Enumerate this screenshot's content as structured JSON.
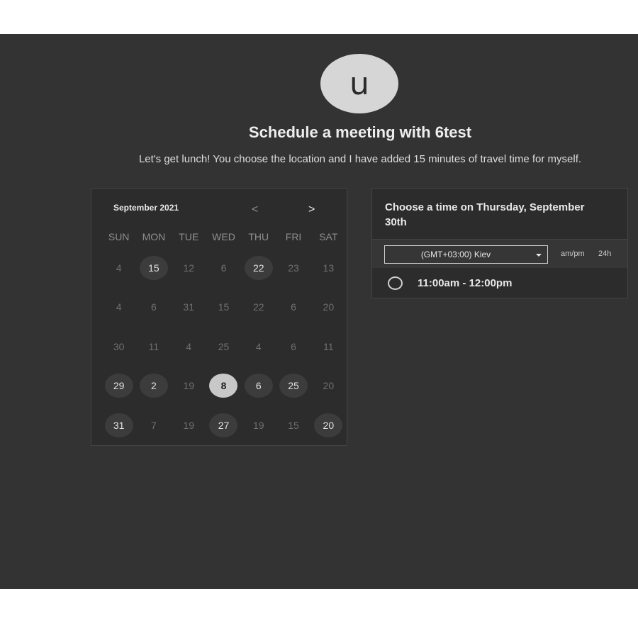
{
  "header": {
    "avatar_initial": "u",
    "title": "Schedule a meeting with 6test",
    "description": "Let's get lunch! You choose the location and I have added 15 minutes of travel time for myself."
  },
  "calendar": {
    "month_label": "September 2021",
    "prev_icon": "chevron-left-icon",
    "next_icon": "chevron-right-icon",
    "prev_glyph": "<",
    "next_glyph": ">",
    "weekdays": [
      "SUN",
      "MON",
      "TUE",
      "WED",
      "THU",
      "FRI",
      "SAT"
    ],
    "weeks": [
      [
        {
          "label": "4",
          "state": "disabled"
        },
        {
          "label": "15",
          "state": "available"
        },
        {
          "label": "12",
          "state": "disabled"
        },
        {
          "label": "6",
          "state": "disabled"
        },
        {
          "label": "22",
          "state": "available"
        },
        {
          "label": "23",
          "state": "disabled"
        },
        {
          "label": "13",
          "state": "disabled"
        }
      ],
      [
        {
          "label": "4",
          "state": "disabled"
        },
        {
          "label": "6",
          "state": "disabled"
        },
        {
          "label": "31",
          "state": "disabled"
        },
        {
          "label": "15",
          "state": "disabled"
        },
        {
          "label": "22",
          "state": "disabled"
        },
        {
          "label": "6",
          "state": "disabled"
        },
        {
          "label": "20",
          "state": "disabled"
        }
      ],
      [
        {
          "label": "30",
          "state": "disabled"
        },
        {
          "label": "11",
          "state": "disabled"
        },
        {
          "label": "4",
          "state": "disabled"
        },
        {
          "label": "25",
          "state": "disabled"
        },
        {
          "label": "4",
          "state": "disabled"
        },
        {
          "label": "6",
          "state": "disabled"
        },
        {
          "label": "11",
          "state": "disabled"
        }
      ],
      [
        {
          "label": "29",
          "state": "available"
        },
        {
          "label": "2",
          "state": "available"
        },
        {
          "label": "19",
          "state": "disabled"
        },
        {
          "label": "8",
          "state": "selected"
        },
        {
          "label": "6",
          "state": "available"
        },
        {
          "label": "25",
          "state": "available"
        },
        {
          "label": "20",
          "state": "disabled"
        }
      ],
      [
        {
          "label": "31",
          "state": "available"
        },
        {
          "label": "7",
          "state": "disabled"
        },
        {
          "label": "19",
          "state": "disabled"
        },
        {
          "label": "27",
          "state": "available"
        },
        {
          "label": "19",
          "state": "disabled"
        },
        {
          "label": "15",
          "state": "disabled"
        },
        {
          "label": "20",
          "state": "available"
        }
      ]
    ]
  },
  "time_panel": {
    "heading": "Choose a time on Thursday, September 30th",
    "timezone": "(GMT+03:00) Kiev",
    "format_ampm": "am/pm",
    "format_24h": "24h",
    "slots": [
      {
        "label": "11:00am - 12:00pm"
      }
    ]
  },
  "colors": {
    "page_bg": "#333333",
    "panel_bg": "#2c2c2c",
    "selected_day": "#c8c8c8",
    "avatar_bg": "#d6d6d6"
  }
}
